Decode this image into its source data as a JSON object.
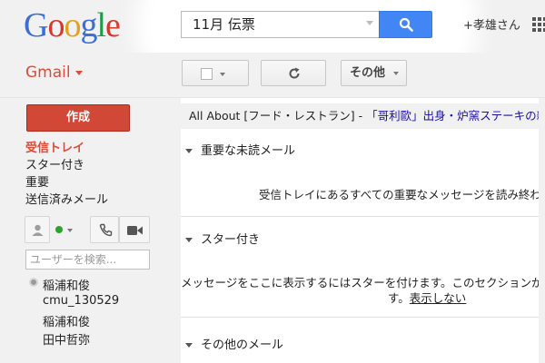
{
  "header": {
    "logo_letters": [
      "G",
      "o",
      "o",
      "g",
      "l",
      "e"
    ],
    "search_value": "11月 伝票",
    "user_name": "+孝雄さん"
  },
  "toolbar": {
    "app_label": "Gmail",
    "more_label": "その他"
  },
  "nav": {
    "compose_label": "作成",
    "items": [
      "受信トレイ",
      "スター付き",
      "重要",
      "送信済みメール"
    ]
  },
  "chat": {
    "search_placeholder": "ユーザーを検索...",
    "contacts": [
      "稲浦和俊",
      "cmu_130529",
      "稲浦和俊",
      "田中哲弥"
    ]
  },
  "main": {
    "ad_prefix": "All About [フード・レストラン] - ",
    "ad_link": "「哥利歐」出身・炉窯ステーキの新店",
    "sections": {
      "important_title": "重要な未読メール",
      "important_message": "受信トレイにあるすべての重要なメッセージを読み終わ",
      "starred_title": "スター付き",
      "starred_message": "メッセージをここに表示するにはスターを付けます。このセクションが",
      "starred_message_end": "す。",
      "starred_hide_link": "表示しない",
      "other_title": "その他のメール"
    }
  },
  "colors": {
    "gmail_red": "#dd4b39",
    "search_blue": "#4285f4",
    "link_blue": "#1a0dab",
    "status_green": "#2aa42a"
  }
}
